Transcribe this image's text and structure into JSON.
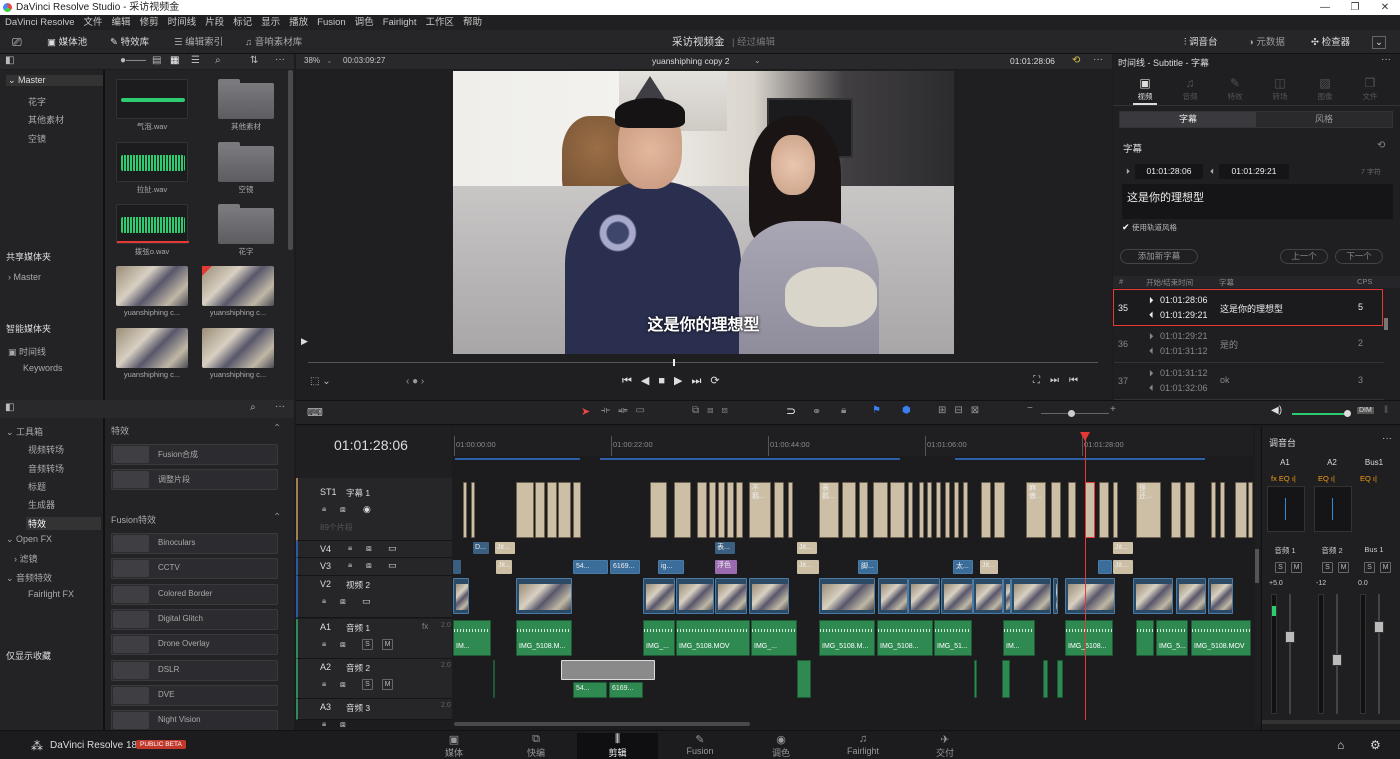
{
  "window": {
    "title": "DaVinci Resolve Studio - 采访视频金"
  },
  "menu": [
    "DaVinci Resolve",
    "文件",
    "编辑",
    "修剪",
    "时间线",
    "片段",
    "标记",
    "显示",
    "播放",
    "Fusion",
    "调色",
    "Fairlight",
    "工作区",
    "帮助"
  ],
  "toolbar": {
    "media_pool": "媒体池",
    "effects_library": "特效库",
    "edit_index": "编辑索引",
    "sound_library": "音响素材库",
    "project_name": "采访视频金",
    "project_state": "经过编辑",
    "mixer": "调音台",
    "metadata": "元数据",
    "inspector": "检查器"
  },
  "viewer": {
    "zoom": "38%",
    "duration": "00:03:09:27",
    "timeline_name": "yuanshiphing copy 2",
    "timecode": "01:01:28:06",
    "subtitle_overlay": "这是你的理想型"
  },
  "media_pool": {
    "root": "Master",
    "bins": [
      "花字",
      "其他素材",
      "空镜"
    ],
    "shared_header": "共享媒体夹",
    "shared_master": "Master",
    "smart_header": "智能媒体夹",
    "smart_items": [
      "时间线",
      "Keywords"
    ],
    "clips": [
      {
        "label": "气泡.wav",
        "kind": "wave"
      },
      {
        "label": "其他素材",
        "kind": "folder"
      },
      {
        "label": "拉扯.wav",
        "kind": "wave"
      },
      {
        "label": "空镜",
        "kind": "folder"
      },
      {
        "label": "拨弦o.wav",
        "kind": "wave"
      },
      {
        "label": "花字",
        "kind": "folder"
      },
      {
        "label": "yuanshiphing c...",
        "kind": "photo"
      },
      {
        "label": "yuanshiphing c...",
        "kind": "photo"
      },
      {
        "label": "yuanshiphing c...",
        "kind": "photo"
      },
      {
        "label": "yuanshiphing c...",
        "kind": "photo"
      }
    ]
  },
  "effects": {
    "tree": [
      "工具箱",
      "视频转场",
      "音频转场",
      "标题",
      "生成器",
      "特效",
      "Open FX",
      "滤镜",
      "音频特效",
      "Fairlight FX"
    ],
    "favorites": "仅显示收藏",
    "section_effects": "特效",
    "section_fusion": "Fusion特效",
    "items": [
      "Fusion合成",
      "调整片段"
    ],
    "fusion_items": [
      "Binoculars",
      "CCTV",
      "Colored Border",
      "Digital Glitch",
      "Drone Overlay",
      "DSLR",
      "DVE",
      "Night Vision"
    ]
  },
  "inspector": {
    "header": "时间线 - Subtitle - 字幕",
    "tabs": [
      "视频",
      "音频",
      "特效",
      "转场",
      "图像",
      "文件"
    ],
    "subtabs": [
      "字幕",
      "风格"
    ],
    "section": "字幕",
    "in_time": "01:01:28:06",
    "out_time": "01:01:29:21",
    "chars": "7 字符",
    "text": "这是你的理想型",
    "use_track_style": "使用轨道风格",
    "add_button": "添加新字幕",
    "prev": "上一个",
    "next": "下一个",
    "columns": [
      "#",
      "开始/结束时间",
      "字幕",
      "CPS"
    ],
    "rows": [
      {
        "n": "35",
        "start": "01:01:28:06",
        "end": "01:01:29:21",
        "text": "这是你的理想型",
        "cps": "5"
      },
      {
        "n": "36",
        "start": "01:01:29:21",
        "end": "01:01:31:12",
        "text": "是的",
        "cps": "2"
      },
      {
        "n": "37",
        "start": "01:01:31:12",
        "end": "01:01:32:06",
        "text": "ok",
        "cps": "3"
      }
    ]
  },
  "timeline": {
    "timecode": "01:01:28:06",
    "ruler": [
      "01:00:00:00",
      "01:00:22:00",
      "01:00:44:00",
      "01:01:06:00",
      "01:01:28:00"
    ],
    "tracks": [
      {
        "id": "ST1",
        "name": "字幕 1",
        "info": "89个片段"
      },
      {
        "id": "V4",
        "name": ""
      },
      {
        "id": "V3",
        "name": ""
      },
      {
        "id": "V2",
        "name": "视频 2"
      },
      {
        "id": "A1",
        "name": "音频 1",
        "level": "2.0"
      },
      {
        "id": "A2",
        "name": "音频 2",
        "level": "2.0"
      },
      {
        "id": "A3",
        "name": "音频 3",
        "level": "2.0"
      }
    ],
    "clip_labels": {
      "v3_a": "54...",
      "v3_b": "6169...",
      "v3_c": "ig...",
      "v3_d": "浮色",
      "a1_a": "IMG_5108.M...",
      "a1_b": "IMG_...",
      "a1_c": "IMG_5108.MOV",
      "a1_d": "IMG_...",
      "a1_e": "IMG_5108.M...",
      "a1_f": "IMG_5108...",
      "a1_g": "IMG_51...",
      "a1_h": "IM...",
      "a1_i": "IMG_5108...",
      "a1_j": "IMG_5...",
      "a1_k": "IMG_5108.MOV",
      "a1_first": "IM...",
      "a2_a": "54...",
      "a2_b": "6169...",
      "st_a": "不\n鹅...",
      "st_b": "表\n鹅...",
      "st_c": "麻\n傲...",
      "st_d": "怪\n还...",
      "v4_a": "D...",
      "v4_b": "Jit...",
      "v4_c": "表...",
      "v4_d": "Jit...",
      "v4_e": "Jit...",
      "v3_e": "Jit...",
      "v3_f": "Jit...",
      "v3_g": "脚...",
      "v3_h": "太...",
      "v3_i": "Jit...",
      "v3_j": "Jit..."
    }
  },
  "mixer": {
    "title": "调音台",
    "channels": [
      "A1",
      "A2",
      "Bus1"
    ],
    "names": [
      "音频 1",
      "音频 2",
      "Bus 1"
    ],
    "levels": [
      "+5.0",
      "-12",
      "0.0"
    ]
  },
  "bottom": {
    "app": "DaVinci Resolve 18",
    "badge": "PUBLIC BETA",
    "pages": [
      "媒体",
      "快编",
      "剪辑",
      "Fusion",
      "调色",
      "Fairlight",
      "交付"
    ]
  }
}
